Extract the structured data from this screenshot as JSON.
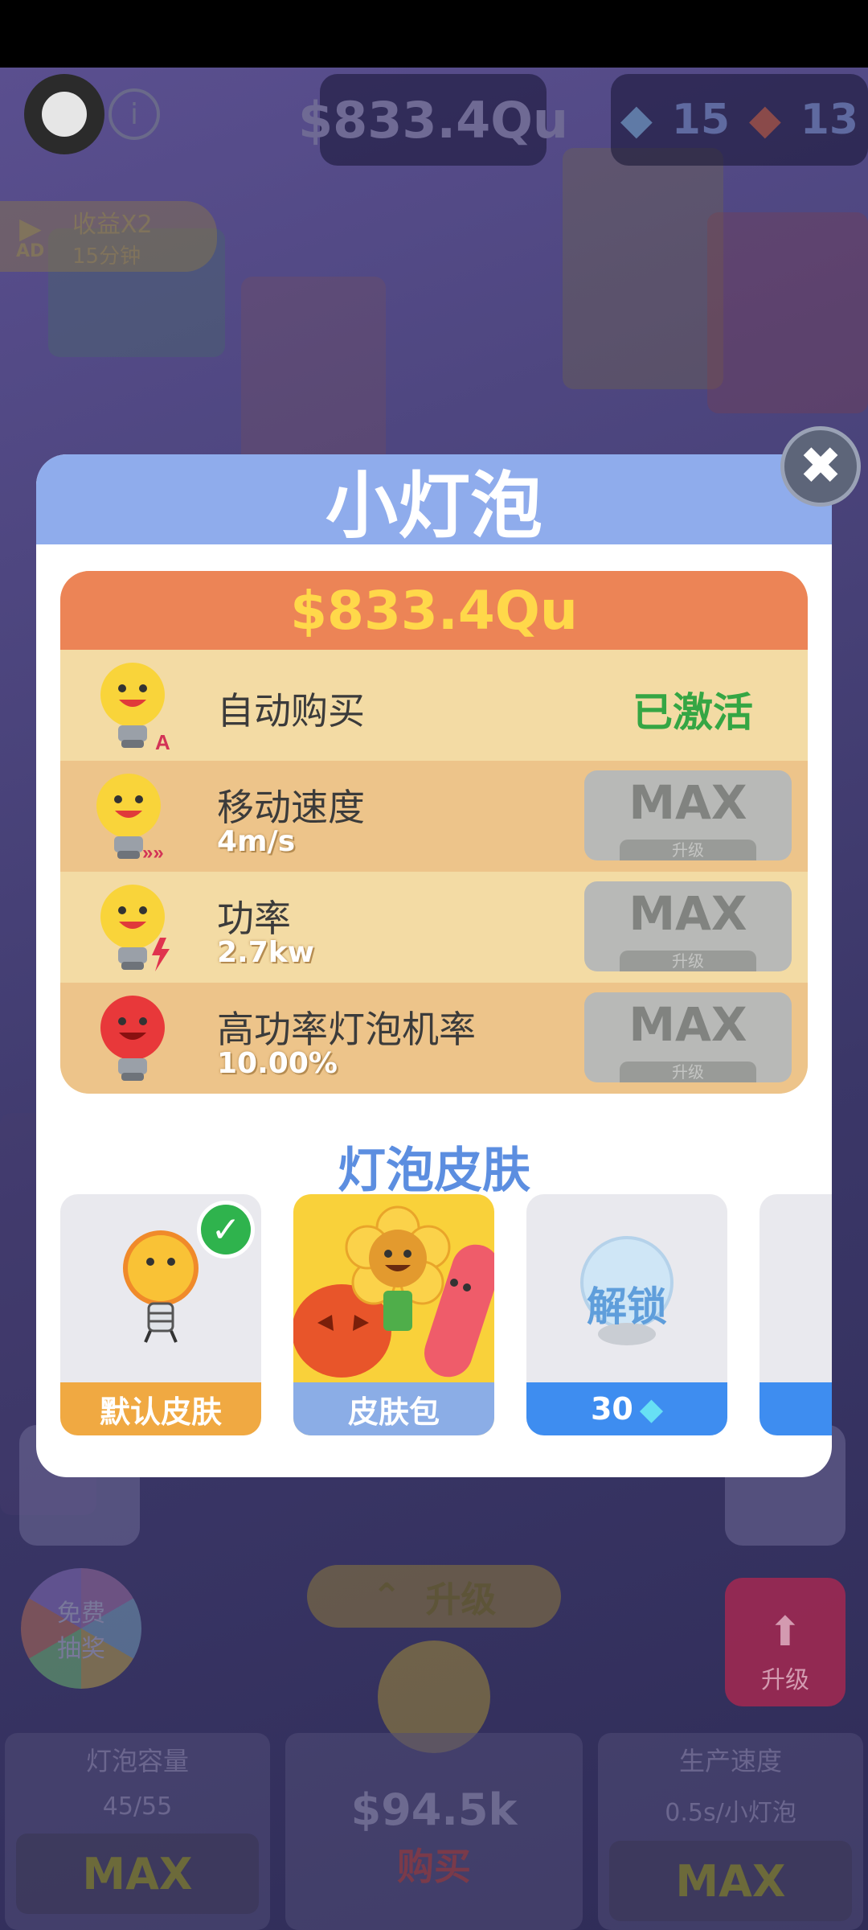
{
  "hud": {
    "money": "$833.4Qu",
    "gems": "15",
    "tickets": "13"
  },
  "ad_boost": {
    "badge": "AD",
    "label": "收益X2",
    "duration": "15分钟"
  },
  "bottom_bar": {
    "capacity": {
      "title": "灯泡容量",
      "value": "45/55",
      "button": "MAX"
    },
    "buy": {
      "price": "$94.5k",
      "label": "购买"
    },
    "speed": {
      "title": "生产速度",
      "value": "0.5s/小灯泡",
      "button": "MAX"
    },
    "upgrade_label": "升级",
    "red_upgrade_label": "升级",
    "wheel_label": "免费抽奖"
  },
  "modal": {
    "title": "小灯泡",
    "close": "✖",
    "price": "$833.4Qu",
    "rows": [
      {
        "label": "自动购买",
        "status": "已激活"
      },
      {
        "label": "移动速度",
        "value": "4m/s",
        "button": "MAX",
        "button_sub": "升级"
      },
      {
        "label": "功率",
        "value": "2.7kw",
        "button": "MAX",
        "button_sub": "升级"
      },
      {
        "label": "高功率灯泡机率",
        "value": "10.00%",
        "button": "MAX",
        "button_sub": "升级"
      }
    ],
    "skins_title": "灯泡皮肤",
    "skins": [
      {
        "label": "默认皮肤",
        "selected": true
      },
      {
        "label": "皮肤包"
      },
      {
        "overlay": "解锁",
        "cost": "30"
      }
    ]
  }
}
